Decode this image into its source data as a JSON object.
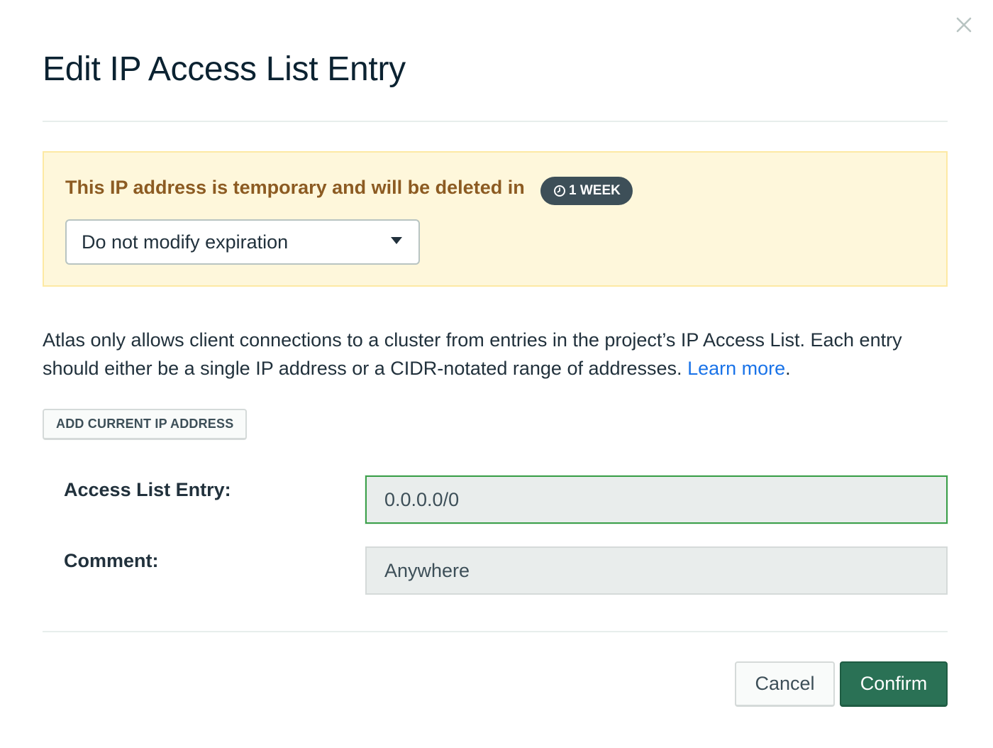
{
  "modal": {
    "title": "Edit IP Access List Entry",
    "close_icon": "close-icon"
  },
  "warning": {
    "text": "This IP address is temporary and will be deleted in",
    "badge_icon": "clock-icon",
    "badge_label": "1 WEEK",
    "expiration_select": {
      "value": "Do not modify expiration",
      "caret_icon": "caret-down-icon"
    }
  },
  "description": {
    "text": "Atlas only allows client connections to a cluster from entries in the project’s IP Access List. Each entry should either be a single IP address or a CIDR-notated range of addresses.",
    "link_text": "Learn more",
    "trailing": "."
  },
  "add_current_ip_label": "ADD CURRENT IP ADDRESS",
  "form": {
    "entry_label": "Access List Entry:",
    "entry_value": "0.0.0.0/0",
    "comment_label": "Comment:",
    "comment_value": "Anywhere"
  },
  "footer": {
    "cancel_label": "Cancel",
    "confirm_label": "Confirm"
  },
  "colors": {
    "warning_bg": "#fef7db",
    "warning_text": "#8c5b22",
    "badge_bg": "#3d4f58",
    "link": "#1a73e8",
    "focus_border": "#3ca04b",
    "confirm_bg": "#2a7155"
  }
}
